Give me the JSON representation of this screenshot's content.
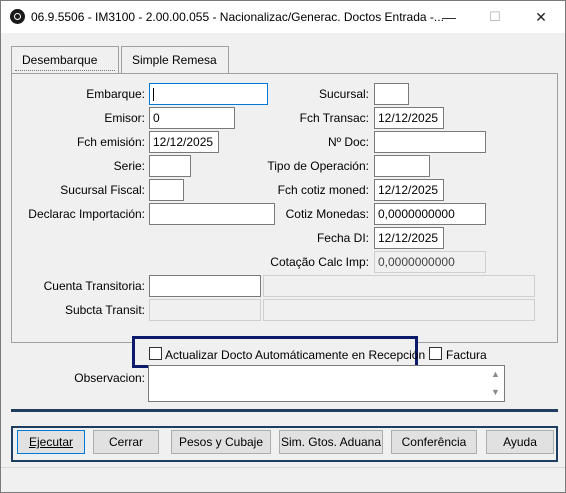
{
  "window": {
    "title": "06.9.5506 - IM3100 - 2.00.00.055 - Nacionalizac/Generac. Doctos Entrada -...",
    "minimize": "—",
    "maximize": "☐",
    "close": "✕"
  },
  "tabs": [
    {
      "label": "Desembarque"
    },
    {
      "label": "Simple Remesa"
    }
  ],
  "form": {
    "embarque": {
      "label": "Embarque:",
      "value": ""
    },
    "emisor": {
      "label": "Emisor:",
      "value": "0"
    },
    "fch_emision": {
      "label": "Fch emisión:",
      "value": "12/12/2025"
    },
    "serie": {
      "label": "Serie:",
      "value": ""
    },
    "sucursal_fiscal": {
      "label": "Sucursal Fiscal:",
      "value": ""
    },
    "declarac_importacion": {
      "label": "Declarac Importación:",
      "value": ""
    },
    "sucursal": {
      "label": "Sucursal:",
      "value": ""
    },
    "fch_transac": {
      "label": "Fch Transac:",
      "value": "12/12/2025"
    },
    "n_doc": {
      "label": "Nº Doc:",
      "value": ""
    },
    "tipo_operacion": {
      "label": "Tipo de Operación:",
      "value": ""
    },
    "fch_cotiz_moned": {
      "label": "Fch cotiz moned:",
      "value": "12/12/2025"
    },
    "cotiz_monedas": {
      "label": "Cotiz Monedas:",
      "value": "0,0000000000"
    },
    "fecha_di": {
      "label": "Fecha DI:",
      "value": "12/12/2025"
    },
    "cotacao_calc_imp": {
      "label": "Cotação Calc Imp:",
      "value": "0,0000000000"
    },
    "cuenta_transitoria": {
      "label": "Cuenta Transitoria:",
      "value": "",
      "desc": ""
    },
    "subcta_transit": {
      "label": "Subcta Transit:",
      "value": "",
      "desc": ""
    }
  },
  "options": {
    "actualizar": {
      "label": "Actualizar Docto Automáticamente en Recepción",
      "checked": false
    },
    "factura": {
      "label": "Factura",
      "checked": false
    }
  },
  "observacion": {
    "label": "Observacion:",
    "value": ""
  },
  "buttons": {
    "ejecutar": "Ejecutar",
    "cerrar": "Cerrar",
    "pesos": "Pesos y Cubaje",
    "sim_gtos": "Sim. Gtos. Aduana",
    "conferencia": "Conferência",
    "ayuda": "Ayuda"
  },
  "colors": {
    "highlight_border": "#0c1a6b",
    "separator": "#1f3d5e",
    "focus": "#0078d7"
  }
}
